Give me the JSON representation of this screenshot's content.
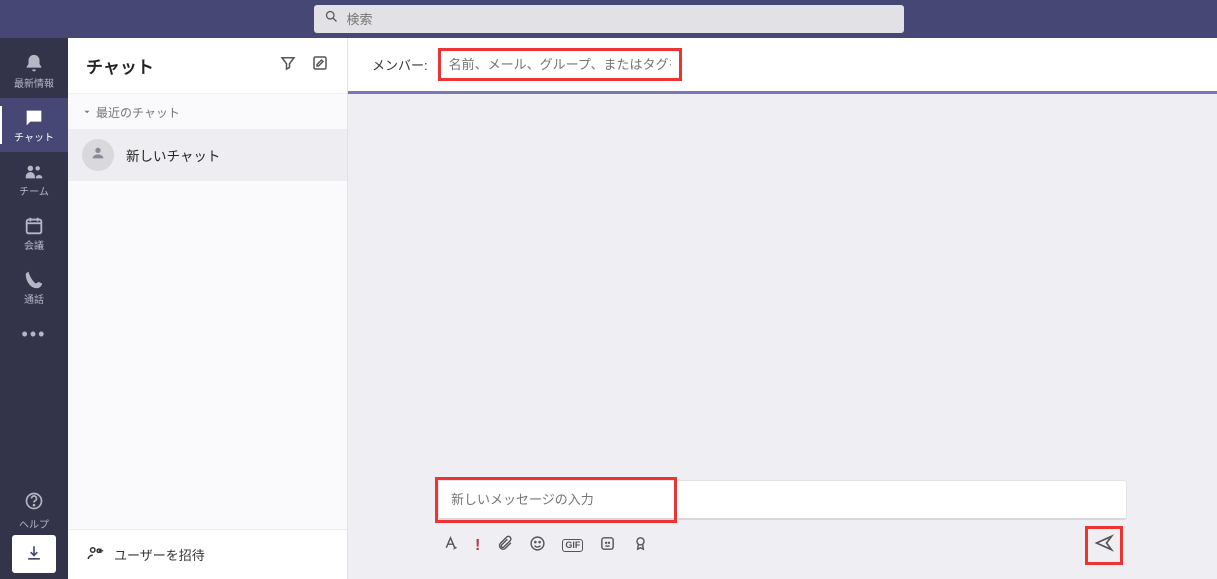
{
  "search": {
    "placeholder": "検索"
  },
  "rail": {
    "activity": "最新情報",
    "chat": "チャット",
    "teams": "チーム",
    "meetings": "会議",
    "calls": "通話",
    "help": "ヘルプ"
  },
  "chatlist": {
    "title": "チャット",
    "section_recent": "最近のチャット",
    "items": [
      {
        "name": "新しいチャット"
      }
    ],
    "invite_label": "ユーザーを招待"
  },
  "chatmain": {
    "member_label": "メンバー:",
    "member_placeholder": "名前、メール、グループ、またはタグを入力",
    "compose_placeholder": "新しいメッセージの入力"
  }
}
